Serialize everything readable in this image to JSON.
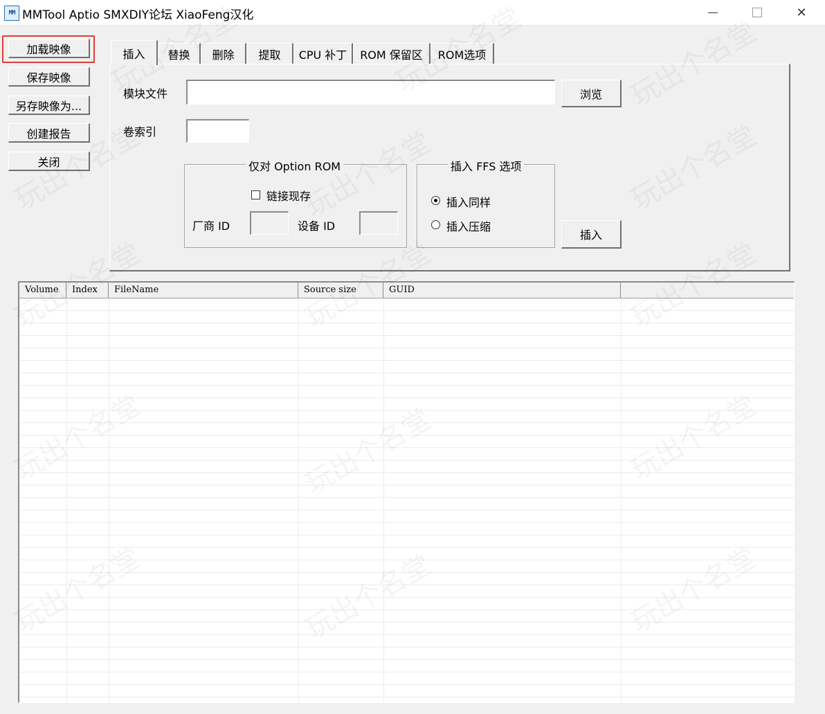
{
  "window": {
    "icon_text": "MM",
    "title": "MMTool Aptio SMXDIY论坛 XiaoFeng汉化",
    "controls": {
      "minimize": "—",
      "maximize": "☐",
      "close": "✕"
    }
  },
  "sidebar": {
    "buttons": [
      {
        "label": "加载映像"
      },
      {
        "label": "保存映像"
      },
      {
        "label": "另存映像为..."
      },
      {
        "label": "创建报告"
      },
      {
        "label": "关闭"
      }
    ]
  },
  "tabs": [
    {
      "label": "插入",
      "active": true
    },
    {
      "label": "替换"
    },
    {
      "label": "删除"
    },
    {
      "label": "提取"
    },
    {
      "label": "CPU 补丁"
    },
    {
      "label": "ROM 保留区"
    },
    {
      "label": "ROM选项"
    }
  ],
  "insert_panel": {
    "module_file_label": "模块文件",
    "module_file_value": "",
    "browse_button": "浏览",
    "volume_index_label": "卷索引",
    "volume_index_value": "",
    "option_rom_group": {
      "title": "仅对 Option ROM",
      "link_existing_label": "链接现存",
      "link_existing_checked": false,
      "vendor_id_label": "厂商 ID",
      "vendor_id_value": "",
      "device_id_label": "设备 ID",
      "device_id_value": ""
    },
    "ffs_group": {
      "title": "插入 FFS 选项",
      "options": [
        {
          "label": "插入同样",
          "selected": true
        },
        {
          "label": "插入压缩",
          "selected": false
        }
      ]
    },
    "insert_button": "插入"
  },
  "file_list": {
    "columns": [
      "Volume",
      "Index",
      "FileName",
      "Source size",
      "GUID",
      ""
    ]
  },
  "watermark": "玩出个名堂"
}
